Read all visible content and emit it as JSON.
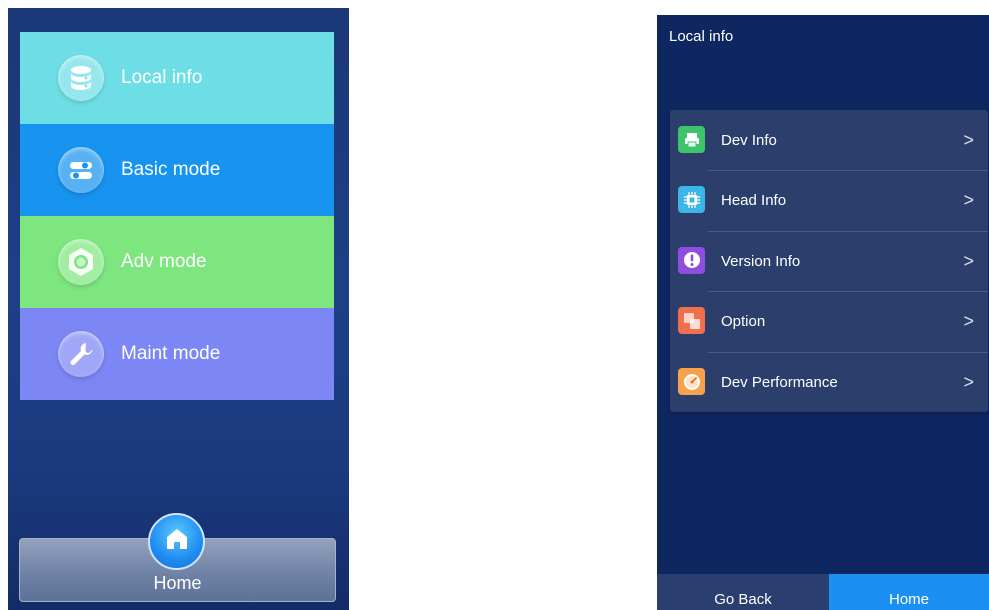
{
  "left_screen": {
    "menu": [
      {
        "label": "Local info",
        "icon": "database-icon",
        "color": "#6edee6"
      },
      {
        "label": "Basic mode",
        "icon": "toggle-switches-icon",
        "color": "#1793f0"
      },
      {
        "label": "Adv mode",
        "icon": "hex-nut-icon",
        "color": "#7de67e"
      },
      {
        "label": "Maint mode",
        "icon": "wrench-icon",
        "color": "#7c86f5"
      }
    ],
    "home_label": "Home"
  },
  "right_screen": {
    "title": "Local info",
    "items": [
      {
        "label": "Dev Info",
        "icon": "printer-icon",
        "color": "#3dc46a"
      },
      {
        "label": "Head Info",
        "icon": "chip-icon",
        "color": "#3bb6e6"
      },
      {
        "label": "Version Info",
        "icon": "exclamation-icon",
        "color": "#8e4ee0"
      },
      {
        "label": "Option",
        "icon": "layers-icon",
        "color": "#f0704e"
      },
      {
        "label": "Dev Performance",
        "icon": "gauge-icon",
        "color": "#f7a24a"
      }
    ],
    "chevron": ">",
    "go_back_label": "Go Back",
    "home_label": "Home"
  }
}
